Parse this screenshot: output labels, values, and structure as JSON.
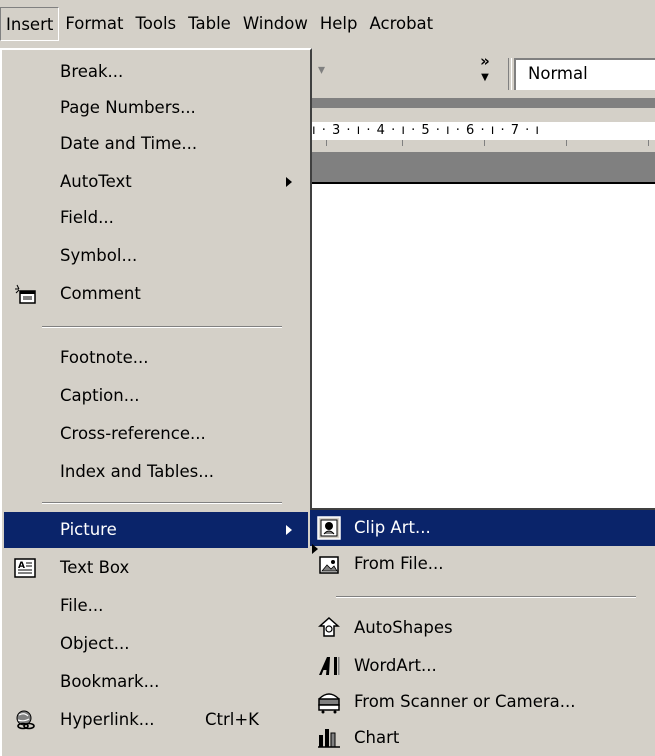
{
  "menubar": {
    "items": [
      {
        "label": "Insert",
        "pressed": true
      },
      {
        "label": "Format",
        "pressed": false
      },
      {
        "label": "Tools",
        "pressed": false
      },
      {
        "label": "Table",
        "pressed": false
      },
      {
        "label": "Window",
        "pressed": false
      },
      {
        "label": "Help",
        "pressed": false
      },
      {
        "label": "Acrobat",
        "pressed": false
      }
    ]
  },
  "toolbar": {
    "overflow_glyph": "»",
    "style_value": "Normal"
  },
  "ruler": {
    "text": "ı · 3 · ı · 4 · ı · 5 · ı · 6 · ı · 7 · ı"
  },
  "insert_menu": {
    "items": [
      {
        "label": "Break...",
        "icon": null
      },
      {
        "label": "Page Numbers...",
        "icon": null
      },
      {
        "label": "Date and Time...",
        "icon": null
      },
      {
        "label": "AutoText",
        "submenu": true,
        "icon": null
      },
      {
        "label": "Field...",
        "icon": null
      },
      {
        "label": "Symbol...",
        "icon": null
      },
      {
        "label": "Comment",
        "icon": "comment-icon"
      },
      {
        "label": "Footnote...",
        "icon": null
      },
      {
        "label": "Caption...",
        "icon": null
      },
      {
        "label": "Cross-reference...",
        "icon": null
      },
      {
        "label": "Index and Tables...",
        "icon": null
      },
      {
        "label": "Picture",
        "submenu": true,
        "active": true,
        "icon": null
      },
      {
        "label": "Text Box",
        "icon": "text-box-icon"
      },
      {
        "label": "File...",
        "icon": null
      },
      {
        "label": "Object...",
        "icon": null
      },
      {
        "label": "Bookmark...",
        "icon": null
      },
      {
        "label": "Hyperlink...",
        "shortcut": "Ctrl+K",
        "icon": "hyperlink-icon"
      }
    ]
  },
  "picture_submenu": {
    "items": [
      {
        "label": "Clip Art...",
        "active": true,
        "icon": "clip-art-icon"
      },
      {
        "label": "From File...",
        "icon": "from-file-icon"
      },
      {
        "label": "AutoShapes",
        "icon": "autoshapes-icon"
      },
      {
        "label": "WordArt...",
        "icon": "wordart-icon"
      },
      {
        "label": "From Scanner or Camera...",
        "icon": "scanner-camera-icon"
      },
      {
        "label": "Chart",
        "icon": "chart-icon"
      }
    ]
  },
  "colors": {
    "menu_face": "#d4d0c8",
    "highlight": "#0a246a",
    "highlight_text": "#ffffff",
    "shadow": "#808080"
  }
}
